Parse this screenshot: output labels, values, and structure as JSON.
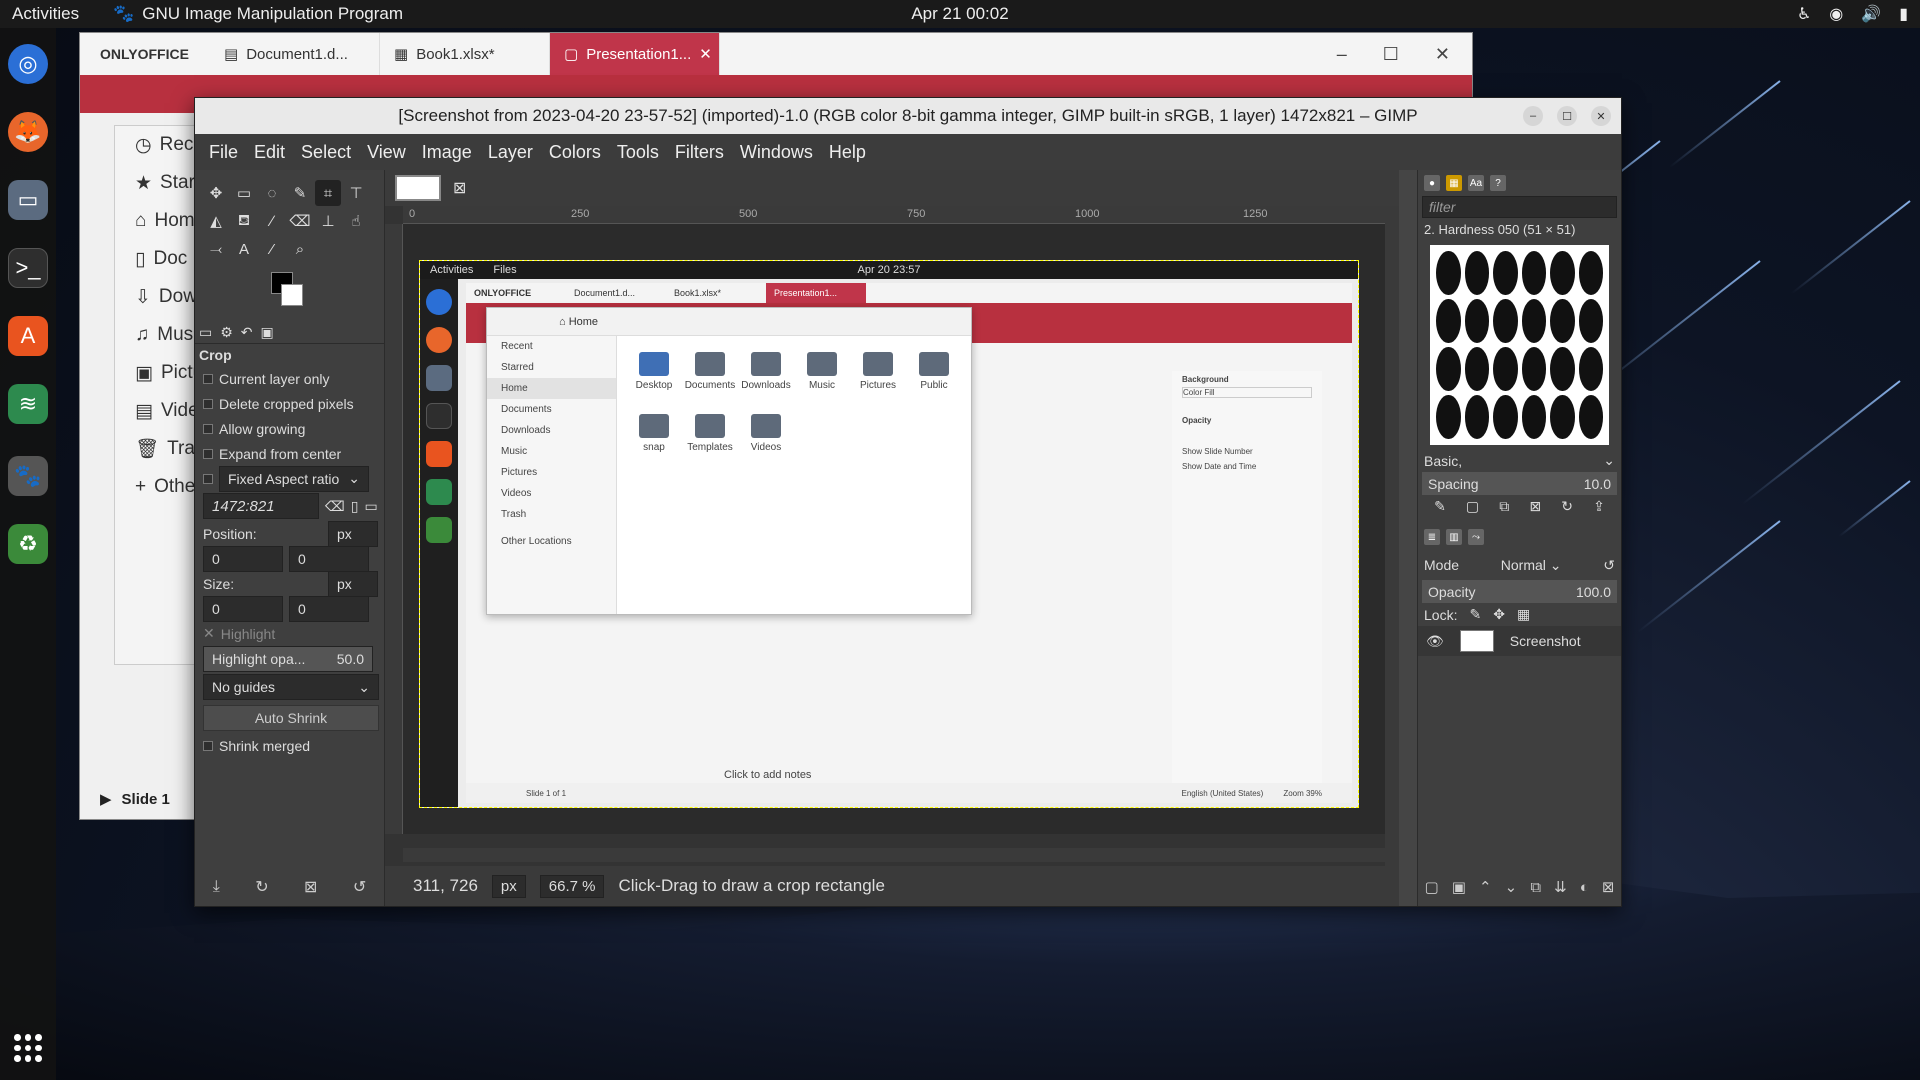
{
  "topbar": {
    "activities": "Activities",
    "app_name": "GNU Image Manipulation Program",
    "clock": "Apr 21  00:02"
  },
  "onlyoffice": {
    "logo": "ONLYOFFICE",
    "tabs": [
      "Document1.d...",
      "Book1.xlsx*",
      "Presentation1..."
    ],
    "sidebar": [
      "Rece",
      "Star",
      "Hom",
      "Doc",
      "Dow",
      "Mus",
      "Pictu",
      "Vide",
      "Tras",
      "Othe"
    ],
    "slide_label": "Slide 1"
  },
  "gimp": {
    "title": "[Screenshot from 2023-04-20 23-57-52] (imported)-1.0 (RGB color 8-bit gamma integer, GIMP built-in sRGB, 1 layer) 1472x821 – GIMP",
    "menu": [
      "File",
      "Edit",
      "Select",
      "View",
      "Image",
      "Layer",
      "Colors",
      "Tools",
      "Filters",
      "Windows",
      "Help"
    ],
    "tool_options": {
      "title": "Crop",
      "checks": [
        "Current layer only",
        "Delete cropped pixels",
        "Allow growing",
        "Expand from center"
      ],
      "fixed": "Fixed Aspect ratio",
      "ratio": "1472:821",
      "position_label": "Position:",
      "position_unit": "px",
      "position_x": "0",
      "position_y": "0",
      "size_label": "Size:",
      "size_unit": "px",
      "size_x": "0",
      "size_y": "0",
      "highlight": "Highlight",
      "highlight_opacity_label": "Highlight opa...",
      "highlight_opacity": "50.0",
      "guides": "No guides",
      "auto_shrink": "Auto Shrink",
      "shrink_merged": "Shrink merged"
    },
    "ruler_ticks": [
      "0",
      "250",
      "500",
      "750",
      "1000",
      "1250"
    ],
    "status": {
      "coords": "311, 726",
      "unit": "px",
      "zoom": "66.7 %",
      "message": "Click-Drag to draw a crop rectangle"
    },
    "brushes": {
      "filter_placeholder": "filter",
      "brush_name": "2. Hardness 050 (51 × 51)",
      "preset": "Basic,",
      "spacing_label": "Spacing",
      "spacing": "10.0"
    },
    "layers": {
      "mode_label": "Mode",
      "mode": "Normal",
      "opacity_label": "Opacity",
      "opacity": "100.0",
      "lock_label": "Lock:",
      "layer_name": "Screenshot"
    }
  },
  "screenshot": {
    "activities": "Activities",
    "files": "Files",
    "clock": "Apr 20  23:57",
    "tabs": [
      "ONLYOFFICE",
      "Document1.d...",
      "Book1.xlsx*",
      "Presentation1..."
    ],
    "files_header": "Home",
    "sidebar": [
      "Recent",
      "Starred",
      "Home",
      "Documents",
      "Downloads",
      "Music",
      "Pictures",
      "Videos",
      "Trash",
      "Other Locations"
    ],
    "folders": [
      "Desktop",
      "Documents",
      "Downloads",
      "Music",
      "Pictures",
      "Public",
      "snap",
      "Templates",
      "Videos"
    ],
    "right_panel": [
      "Background",
      "Color Fill",
      "Opacity",
      "Show Slide Number",
      "Show Date and Time"
    ],
    "notes": "Click to add notes",
    "slide_status": "Slide 1 of 1",
    "language": "English (United States)",
    "zoom": "Zoom 39%"
  }
}
